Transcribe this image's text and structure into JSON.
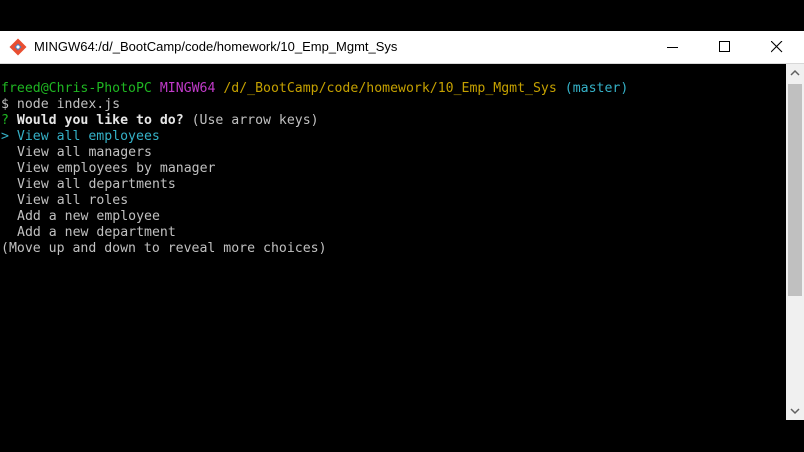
{
  "window": {
    "title": "MINGW64:/d/_BootCamp/code/homework/10_Emp_Mgmt_Sys",
    "icon": "git-bash-icon"
  },
  "titlebar_buttons": {
    "minimize": "minimize-icon",
    "maximize": "maximize-icon",
    "close": "close-icon"
  },
  "terminal": {
    "prompt": {
      "user_host": "freed@Chris-PhotoPC",
      "shell": "MINGW64",
      "path": "/d/_BootCamp/code/homework/10_Emp_Mgmt_Sys",
      "branch": "(master)"
    },
    "command_line": "$ node index.js",
    "question": {
      "marker": "?",
      "text": "Would you like to do?",
      "hint": "(Use arrow keys)"
    },
    "selected_choice": {
      "pointer": ">",
      "label": "View all employees"
    },
    "choices": [
      "View all managers",
      "View employees by manager",
      "View all departments",
      "View all roles",
      "Add a new employee",
      "Add a new department"
    ],
    "footer_hint": "(Move up and down to reveal more choices)"
  },
  "colors": {
    "prompt_user": "#1fb622",
    "prompt_shell": "#c13ac9",
    "prompt_path": "#c4a000",
    "prompt_branch": "#35b1c7",
    "question_marker": "#1fb622",
    "selected": "#35b1c7",
    "text": "#c0c0c0"
  }
}
